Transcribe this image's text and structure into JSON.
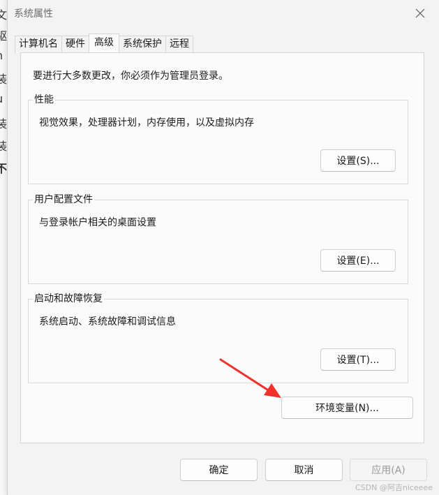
{
  "window": {
    "title": "系统属性"
  },
  "background_chars": [
    "文",
    "驱",
    "h",
    "装",
    "u",
    "装",
    "装",
    "不"
  ],
  "tabs": [
    {
      "label": "计算机名",
      "active": false
    },
    {
      "label": "硬件",
      "active": false
    },
    {
      "label": "高级",
      "active": true
    },
    {
      "label": "系统保护",
      "active": false
    },
    {
      "label": "远程",
      "active": false
    }
  ],
  "advanced": {
    "admin_note": "要进行大多数更改，你必须作为管理员登录。",
    "performance": {
      "title": "性能",
      "description": "视觉效果，处理器计划，内存使用，以及虚拟内存",
      "button": "设置(S)..."
    },
    "user_profiles": {
      "title": "用户配置文件",
      "description": "与登录帐户相关的桌面设置",
      "button": "设置(E)..."
    },
    "startup_recovery": {
      "title": "启动和故障恢复",
      "description": "系统启动、系统故障和调试信息",
      "button": "设置(T)..."
    },
    "env_button": "环境变量(N)..."
  },
  "footer": {
    "ok": "确定",
    "cancel": "取消",
    "apply": "应用(A)"
  },
  "watermark": "CSDN @阿吉niceeee",
  "colors": {
    "arrow": "#f2302c"
  },
  "icons": {
    "close": "close-icon"
  }
}
